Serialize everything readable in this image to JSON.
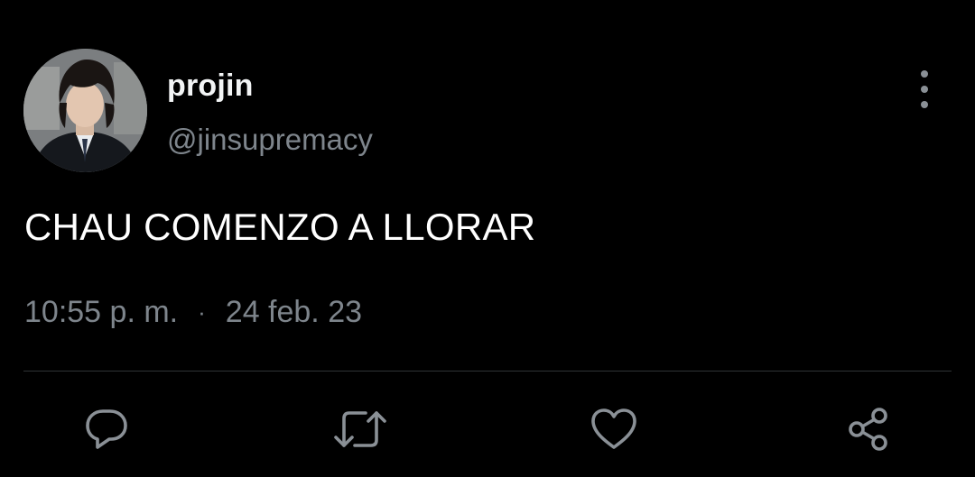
{
  "tweet": {
    "author": {
      "display_name": "projin",
      "handle": "@jinsupremacy"
    },
    "text": "CHAU COMENZO A LLORAR",
    "time": "10:55 p. m.",
    "separator": "·",
    "date": "24 feb. 23"
  },
  "actions": {
    "reply_icon": "reply-icon",
    "retweet_icon": "retweet-icon",
    "like_icon": "heart-icon",
    "share_icon": "share-icon",
    "more_icon": "more-vertical-icon"
  },
  "colors": {
    "background": "#000000",
    "text_primary": "#ffffff",
    "text_secondary": "#7e858c",
    "icon": "#8a9096",
    "divider": "#2f3336"
  }
}
